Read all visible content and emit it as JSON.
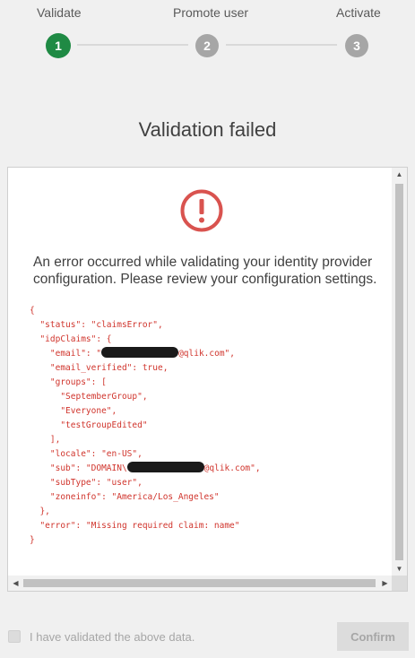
{
  "stepper": {
    "steps": [
      {
        "label": "Validate",
        "number": "1"
      },
      {
        "label": "Promote user",
        "number": "2"
      },
      {
        "label": "Activate",
        "number": "3"
      }
    ],
    "active_color": "#1f8a44",
    "inactive_color": "#a6a6a6"
  },
  "title": "Validation failed",
  "panel": {
    "icon": "error-circle-icon",
    "icon_color": "#d9534f",
    "message": "An error occurred while validating your identity provider configuration. Please review your configuration settings.",
    "json_lines": {
      "l1": "{",
      "l2": "  \"status\": \"claimsError\",",
      "l3": "  \"idpClaims\": {",
      "l4_pre": "    \"email\": \"",
      "l4_post": "@qlik.com\",",
      "l5": "    \"email_verified\": true,",
      "l6": "    \"groups\": [",
      "l7": "      \"SeptemberGroup\",",
      "l8": "      \"Everyone\",",
      "l9": "      \"testGroupEdited\"",
      "l10": "    ],",
      "l11": "    \"locale\": \"en-US\",",
      "l12_pre": "    \"sub\": \"DOMAIN\\",
      "l12_post": "@qlik.com\",",
      "l13": "    \"subType\": \"user\",",
      "l14": "    \"zoneinfo\": \"America/Los_Angeles\"",
      "l15": "  },",
      "l16": "  \"error\": \"Missing required claim: name\"",
      "l17": "}"
    },
    "json_color": "#d0342c"
  },
  "footer": {
    "checkbox_label": "I have validated the above data.",
    "checkbox_checked": false,
    "confirm_label": "Confirm"
  }
}
